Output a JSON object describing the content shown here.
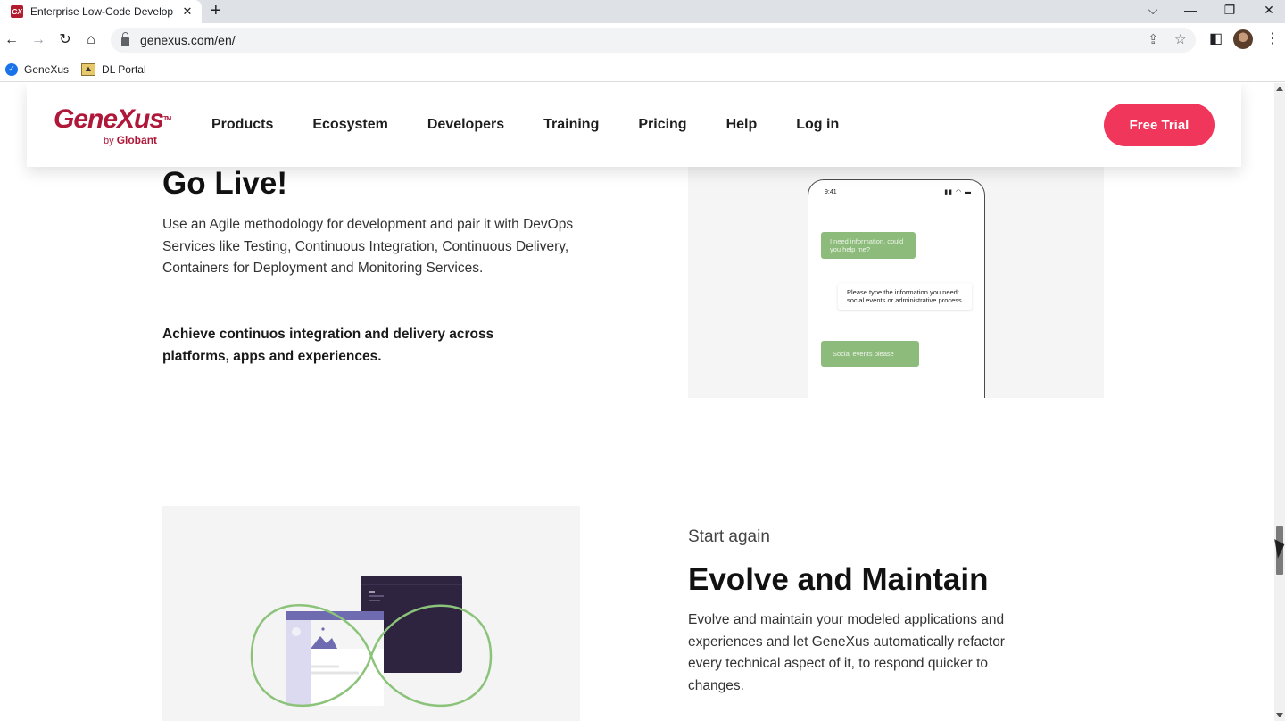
{
  "browser": {
    "tab_title": "Enterprise Low-Code Developme",
    "tab_close": "✕",
    "favicon_text": "GX",
    "new_tab": "+",
    "url": "genexus.com/en/",
    "bookmarks": [
      {
        "label": "GeneXus",
        "icon": "check-circle-icon"
      },
      {
        "label": "DL Portal",
        "icon": "portal-icon"
      }
    ]
  },
  "site": {
    "logo": {
      "text": "GeneXus",
      "tm": "TM",
      "by": "by",
      "brand": "Globant"
    },
    "nav": [
      "Products",
      "Ecosystem",
      "Developers",
      "Training",
      "Pricing",
      "Help",
      "Log in"
    ],
    "cta_label": "Free Trial",
    "brand_color": "#b0183a",
    "cta_color": "#f0365a"
  },
  "section_live": {
    "title": "Go Live!",
    "body": "Use an Agile methodology for development and pair it with DevOps Services like Testing, Continuous Integration, Continuous Delivery, Containers for Deployment and Monitoring Services.",
    "strong": "Achieve continuos integration and delivery across platforms, apps and experiences.",
    "phone": {
      "time": "9:41",
      "messages": [
        "I need information, could you help me?",
        "Please type the information you need: social events or administrative process",
        "Social events please"
      ]
    }
  },
  "section_evolve": {
    "eyebrow": "Start again",
    "title": "Evolve and Maintain",
    "body": "Evolve and maintain your modeled applications and experiences and let GeneXus automatically refactor every technical aspect of it, to respond quicker to changes."
  }
}
